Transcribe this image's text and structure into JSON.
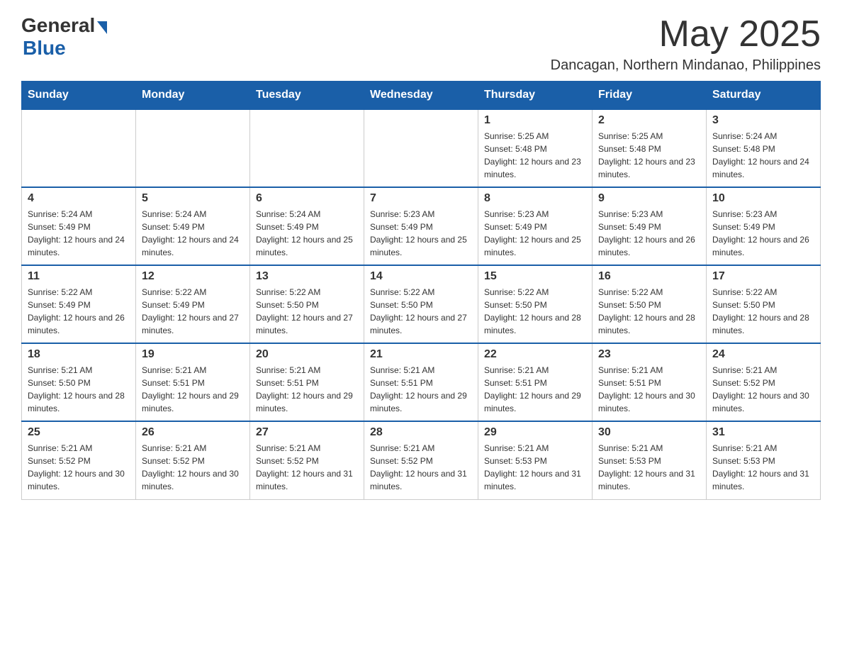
{
  "header": {
    "logo_general": "General",
    "logo_blue": "Blue",
    "month_title": "May 2025",
    "location": "Dancagan, Northern Mindanao, Philippines"
  },
  "weekdays": [
    "Sunday",
    "Monday",
    "Tuesday",
    "Wednesday",
    "Thursday",
    "Friday",
    "Saturday"
  ],
  "weeks": [
    [
      {
        "day": "",
        "sunrise": "",
        "sunset": "",
        "daylight": ""
      },
      {
        "day": "",
        "sunrise": "",
        "sunset": "",
        "daylight": ""
      },
      {
        "day": "",
        "sunrise": "",
        "sunset": "",
        "daylight": ""
      },
      {
        "day": "",
        "sunrise": "",
        "sunset": "",
        "daylight": ""
      },
      {
        "day": "1",
        "sunrise": "Sunrise: 5:25 AM",
        "sunset": "Sunset: 5:48 PM",
        "daylight": "Daylight: 12 hours and 23 minutes."
      },
      {
        "day": "2",
        "sunrise": "Sunrise: 5:25 AM",
        "sunset": "Sunset: 5:48 PM",
        "daylight": "Daylight: 12 hours and 23 minutes."
      },
      {
        "day": "3",
        "sunrise": "Sunrise: 5:24 AM",
        "sunset": "Sunset: 5:48 PM",
        "daylight": "Daylight: 12 hours and 24 minutes."
      }
    ],
    [
      {
        "day": "4",
        "sunrise": "Sunrise: 5:24 AM",
        "sunset": "Sunset: 5:49 PM",
        "daylight": "Daylight: 12 hours and 24 minutes."
      },
      {
        "day": "5",
        "sunrise": "Sunrise: 5:24 AM",
        "sunset": "Sunset: 5:49 PM",
        "daylight": "Daylight: 12 hours and 24 minutes."
      },
      {
        "day": "6",
        "sunrise": "Sunrise: 5:24 AM",
        "sunset": "Sunset: 5:49 PM",
        "daylight": "Daylight: 12 hours and 25 minutes."
      },
      {
        "day": "7",
        "sunrise": "Sunrise: 5:23 AM",
        "sunset": "Sunset: 5:49 PM",
        "daylight": "Daylight: 12 hours and 25 minutes."
      },
      {
        "day": "8",
        "sunrise": "Sunrise: 5:23 AM",
        "sunset": "Sunset: 5:49 PM",
        "daylight": "Daylight: 12 hours and 25 minutes."
      },
      {
        "day": "9",
        "sunrise": "Sunrise: 5:23 AM",
        "sunset": "Sunset: 5:49 PM",
        "daylight": "Daylight: 12 hours and 26 minutes."
      },
      {
        "day": "10",
        "sunrise": "Sunrise: 5:23 AM",
        "sunset": "Sunset: 5:49 PM",
        "daylight": "Daylight: 12 hours and 26 minutes."
      }
    ],
    [
      {
        "day": "11",
        "sunrise": "Sunrise: 5:22 AM",
        "sunset": "Sunset: 5:49 PM",
        "daylight": "Daylight: 12 hours and 26 minutes."
      },
      {
        "day": "12",
        "sunrise": "Sunrise: 5:22 AM",
        "sunset": "Sunset: 5:49 PM",
        "daylight": "Daylight: 12 hours and 27 minutes."
      },
      {
        "day": "13",
        "sunrise": "Sunrise: 5:22 AM",
        "sunset": "Sunset: 5:50 PM",
        "daylight": "Daylight: 12 hours and 27 minutes."
      },
      {
        "day": "14",
        "sunrise": "Sunrise: 5:22 AM",
        "sunset": "Sunset: 5:50 PM",
        "daylight": "Daylight: 12 hours and 27 minutes."
      },
      {
        "day": "15",
        "sunrise": "Sunrise: 5:22 AM",
        "sunset": "Sunset: 5:50 PM",
        "daylight": "Daylight: 12 hours and 28 minutes."
      },
      {
        "day": "16",
        "sunrise": "Sunrise: 5:22 AM",
        "sunset": "Sunset: 5:50 PM",
        "daylight": "Daylight: 12 hours and 28 minutes."
      },
      {
        "day": "17",
        "sunrise": "Sunrise: 5:22 AM",
        "sunset": "Sunset: 5:50 PM",
        "daylight": "Daylight: 12 hours and 28 minutes."
      }
    ],
    [
      {
        "day": "18",
        "sunrise": "Sunrise: 5:21 AM",
        "sunset": "Sunset: 5:50 PM",
        "daylight": "Daylight: 12 hours and 28 minutes."
      },
      {
        "day": "19",
        "sunrise": "Sunrise: 5:21 AM",
        "sunset": "Sunset: 5:51 PM",
        "daylight": "Daylight: 12 hours and 29 minutes."
      },
      {
        "day": "20",
        "sunrise": "Sunrise: 5:21 AM",
        "sunset": "Sunset: 5:51 PM",
        "daylight": "Daylight: 12 hours and 29 minutes."
      },
      {
        "day": "21",
        "sunrise": "Sunrise: 5:21 AM",
        "sunset": "Sunset: 5:51 PM",
        "daylight": "Daylight: 12 hours and 29 minutes."
      },
      {
        "day": "22",
        "sunrise": "Sunrise: 5:21 AM",
        "sunset": "Sunset: 5:51 PM",
        "daylight": "Daylight: 12 hours and 29 minutes."
      },
      {
        "day": "23",
        "sunrise": "Sunrise: 5:21 AM",
        "sunset": "Sunset: 5:51 PM",
        "daylight": "Daylight: 12 hours and 30 minutes."
      },
      {
        "day": "24",
        "sunrise": "Sunrise: 5:21 AM",
        "sunset": "Sunset: 5:52 PM",
        "daylight": "Daylight: 12 hours and 30 minutes."
      }
    ],
    [
      {
        "day": "25",
        "sunrise": "Sunrise: 5:21 AM",
        "sunset": "Sunset: 5:52 PM",
        "daylight": "Daylight: 12 hours and 30 minutes."
      },
      {
        "day": "26",
        "sunrise": "Sunrise: 5:21 AM",
        "sunset": "Sunset: 5:52 PM",
        "daylight": "Daylight: 12 hours and 30 minutes."
      },
      {
        "day": "27",
        "sunrise": "Sunrise: 5:21 AM",
        "sunset": "Sunset: 5:52 PM",
        "daylight": "Daylight: 12 hours and 31 minutes."
      },
      {
        "day": "28",
        "sunrise": "Sunrise: 5:21 AM",
        "sunset": "Sunset: 5:52 PM",
        "daylight": "Daylight: 12 hours and 31 minutes."
      },
      {
        "day": "29",
        "sunrise": "Sunrise: 5:21 AM",
        "sunset": "Sunset: 5:53 PM",
        "daylight": "Daylight: 12 hours and 31 minutes."
      },
      {
        "day": "30",
        "sunrise": "Sunrise: 5:21 AM",
        "sunset": "Sunset: 5:53 PM",
        "daylight": "Daylight: 12 hours and 31 minutes."
      },
      {
        "day": "31",
        "sunrise": "Sunrise: 5:21 AM",
        "sunset": "Sunset: 5:53 PM",
        "daylight": "Daylight: 12 hours and 31 minutes."
      }
    ]
  ]
}
